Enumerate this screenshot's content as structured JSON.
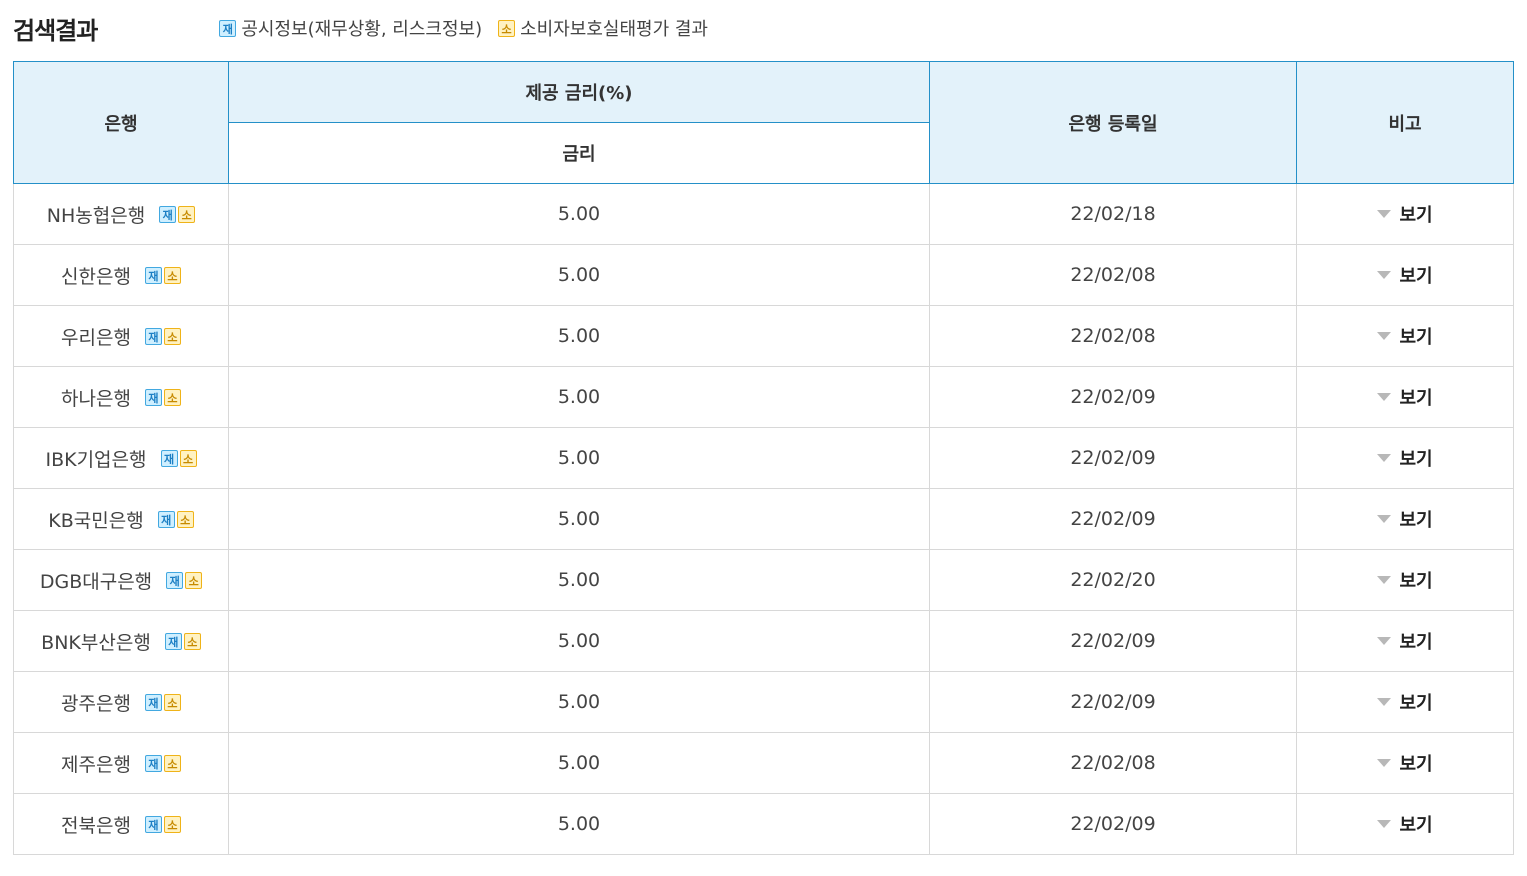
{
  "header": {
    "title": "검색결과",
    "legend": [
      {
        "badge": "재",
        "label": "공시정보(재무상황, 리스크정보)"
      },
      {
        "badge": "소",
        "label": "소비자보호실태평가 결과"
      }
    ]
  },
  "table": {
    "headers": {
      "bank": "은행",
      "rate_group": "제공 금리(%)",
      "rate": "금리",
      "reg_date": "은행 등록일",
      "note": "비고"
    },
    "badges": {
      "jae": "재",
      "so": "소"
    },
    "view_label": "보기",
    "rows": [
      {
        "bank": "NH농협은행",
        "rate": "5.00",
        "date": "22/02/18"
      },
      {
        "bank": "신한은행",
        "rate": "5.00",
        "date": "22/02/08"
      },
      {
        "bank": "우리은행",
        "rate": "5.00",
        "date": "22/02/08"
      },
      {
        "bank": "하나은행",
        "rate": "5.00",
        "date": "22/02/09"
      },
      {
        "bank": "IBK기업은행",
        "rate": "5.00",
        "date": "22/02/09"
      },
      {
        "bank": "KB국민은행",
        "rate": "5.00",
        "date": "22/02/09"
      },
      {
        "bank": "DGB대구은행",
        "rate": "5.00",
        "date": "22/02/20"
      },
      {
        "bank": "BNK부산은행",
        "rate": "5.00",
        "date": "22/02/09"
      },
      {
        "bank": "광주은행",
        "rate": "5.00",
        "date": "22/02/09"
      },
      {
        "bank": "제주은행",
        "rate": "5.00",
        "date": "22/02/08"
      },
      {
        "bank": "전북은행",
        "rate": "5.00",
        "date": "22/02/09"
      }
    ]
  },
  "colors": {
    "header_bg": "#e3f2fa",
    "header_border": "#2490c8",
    "badge_jae": "#42a8e0",
    "badge_so": "#efb318"
  }
}
